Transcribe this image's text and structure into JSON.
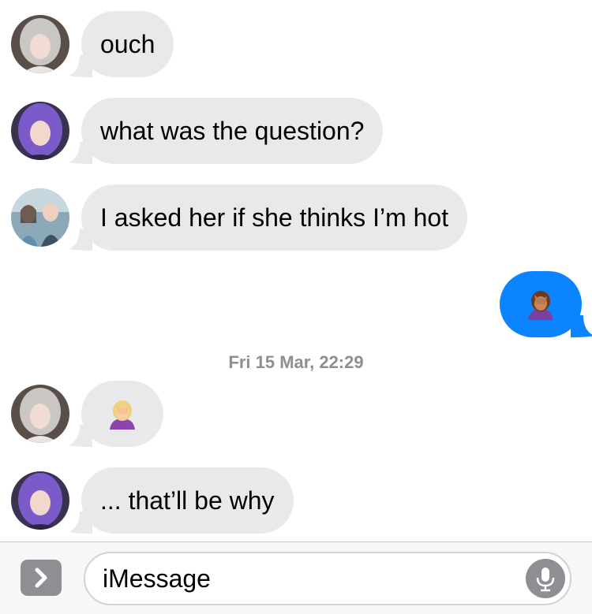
{
  "messages": [
    {
      "type": "incoming",
      "avatar": "grey-hair-avatar",
      "text": "ouch"
    },
    {
      "type": "incoming",
      "avatar": "purple-hair-avatar",
      "text": "what was the question?"
    },
    {
      "type": "incoming",
      "avatar": "group-photo-avatar",
      "text": "I asked her if she thinks I’m hot"
    },
    {
      "type": "outgoing",
      "emoji": "face-palm-emoji-brown"
    },
    {
      "type": "timestamp",
      "text": "Fri 15 Mar, 22:29"
    },
    {
      "type": "incoming",
      "avatar": "grey-hair-avatar",
      "emoji": "face-palm-emoji-blonde"
    },
    {
      "type": "incoming",
      "avatar": "purple-hair-avatar",
      "text": "... that’ll be why"
    }
  ],
  "input": {
    "placeholder": "iMessage",
    "apps_icon": "chevron-right-icon",
    "mic_icon": "microphone-icon"
  },
  "colors": {
    "incoming_bubble": "#e9e9eb",
    "outgoing_bubble": "#0b84fe",
    "timestamp": "#8e8e93"
  }
}
